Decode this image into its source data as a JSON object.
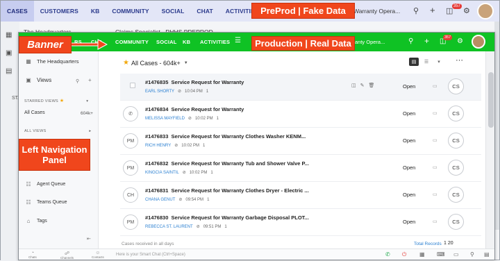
{
  "preprod": {
    "tabs": [
      "CASES",
      "CUSTOMERS",
      "KB",
      "COMMUNITY",
      "SOCIAL",
      "CHAT",
      "ACTIVITIES"
    ],
    "active_tab": "CASES",
    "warranty_label": "Warranty Opera...",
    "notification_count": "357",
    "sidebar_hq": "The Headquarters",
    "breadcrumb": "Claims Specialist - RHHS PREPROD",
    "starred_label": "STA"
  },
  "callouts": {
    "preprod": "PreProd | Fake Data",
    "production": "Production | Real Data",
    "banner": "Banner",
    "left_nav": "Left Navigation Panel"
  },
  "production": {
    "tabs": [
      "COMMUNITY",
      "SOCIAL",
      "KB",
      "ACTIVITIES"
    ],
    "partial_tabs": [
      "RS",
      "CHA"
    ],
    "warranty_label": "anty Opera...",
    "notification_count": "357",
    "banner_color": "#0fc224"
  },
  "nav": {
    "headquarters": "The Headquarters",
    "views": "Views",
    "starred_views": "STARRED VIEWS",
    "all_cases": "All Cases",
    "all_cases_count": "604k+",
    "all_views": "ALL VIEWS",
    "agent_queue": "Agent Queue",
    "teams_queue": "Teams Queue",
    "tags": "Tags"
  },
  "list": {
    "title": "All Cases - 604k+",
    "footer_received": "Cases received in all days",
    "footer_total": "Total Records",
    "page_size": "1  20"
  },
  "cases": [
    {
      "id": "#1476835",
      "subject": "Service Request for Warranty",
      "contact": "EARL SHORTY",
      "time": "10:04 PM",
      "threads": "1",
      "status": "Open",
      "assignee": "CS",
      "avatar": ""
    },
    {
      "id": "#1476834",
      "subject": "Service Request for Warranty",
      "contact": "MELISSA MAYFIELD",
      "time": "10:02 PM",
      "threads": "1",
      "status": "Open",
      "assignee": "CS",
      "avatar": "phone-icon"
    },
    {
      "id": "#1476833",
      "subject": "Service Request for Warranty Clothes Washer KENM...",
      "contact": "RICH HENRY",
      "time": "10:02 PM",
      "threads": "1",
      "status": "Open",
      "assignee": "CS",
      "avatar": "PM"
    },
    {
      "id": "#1476832",
      "subject": "Service Request for Warranty Tub and Shower Valve P...",
      "contact": "KINGCIA SAINTIL",
      "time": "10:02 PM",
      "threads": "1",
      "status": "Open",
      "assignee": "CS",
      "avatar": "PM"
    },
    {
      "id": "#1476831",
      "subject": "Service Request for Warranty Clothes Dryer - Electric ...",
      "contact": "CHANA GENUT",
      "time": "09:54 PM",
      "threads": "1",
      "status": "Open",
      "assignee": "CS",
      "avatar": "CH"
    },
    {
      "id": "#1476830",
      "subject": "Service Request for Warranty Garbage Disposal PLOT...",
      "contact": "REBECCA ST. LAURENT",
      "time": "09:51 PM",
      "threads": "1",
      "status": "Open",
      "assignee": "CS",
      "avatar": "PM"
    }
  ],
  "bottom": {
    "tabs": [
      "Chats",
      "Channels",
      "Contacts"
    ],
    "smart_chat_placeholder": "Here is your Smart Chat (Ctrl+Space)"
  }
}
